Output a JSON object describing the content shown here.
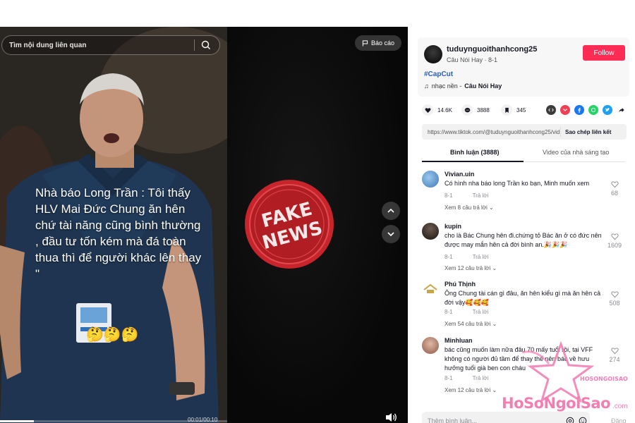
{
  "video": {
    "search_placeholder": "Tìm nội dung liên quan",
    "report_label": "Báo cáo",
    "caption": "Nhà báo Long Trần : Tôi thấy HLV Mai Đức Chung ăn hên chứ tài năng cũng bình thường , đầu tư tốn kém mà đá toàn thua thì để người khác lên thay \"",
    "caption_emojis": "🤔🤔🤔",
    "stamp_top": "FAKE",
    "stamp_bottom": "NEWS",
    "time": "00:01/00:10",
    "progress": 0.15
  },
  "author": {
    "username": "tuduynguoithanhcong25",
    "subtitle": "Câu Nói Hay · 8-1",
    "follow_label": "Follow",
    "hashtag": "#CapCut",
    "music_prefix": "nhạc nền - ",
    "music_name": "Câu Nói Hay"
  },
  "stats": {
    "likes": "14.6K",
    "comments": "3888",
    "saves": "345"
  },
  "share_icons": [
    "embed-icon",
    "pocket-icon",
    "facebook-icon",
    "whatsapp-icon",
    "twitter-icon",
    "share-arrow-icon"
  ],
  "link": {
    "url": "https://www.tiktok.com/@tuduynguoithanhcong25/vid",
    "copy_label": "Sao chép liên kết"
  },
  "tabs": {
    "comments": "Bình luận (3888)",
    "creator_videos": "Video của nhà sáng tạo"
  },
  "comments": [
    {
      "user": "Vivian.uin",
      "text": "Có hình nha báo long Trần ko bạn, Minh muốn xem",
      "date": "8-1",
      "reply_label": "Trả lời",
      "likes": "68",
      "view_replies": "Xem 8 câu trả lời",
      "avatar_color": "#4f8fc9"
    },
    {
      "user": "kupin",
      "text": "cho là Bác Chung hên đi.chứng tỏ Bác ăn ở có đức nên được may mắn hên cả đời bình an.🎉🎉🎉",
      "date": "8-1",
      "reply_label": "Trả lời",
      "likes": "1609",
      "view_replies": "Xem 12 câu trả lời",
      "avatar_color": "#2a2220"
    },
    {
      "user": "Phú Thịnh",
      "text": "Ông Chung tài cán gì đâu, ăn hên kiểu gì mà ăn hên cả đời vậy🥰🥰🥰",
      "date": "8-1",
      "reply_label": "Trả lời",
      "likes": "508",
      "view_replies": "Xem 54 câu trả lời",
      "avatar_color": "#c9a54a"
    },
    {
      "user": "Minhluan",
      "text": "bác cũng muốn làm nữa đâu 70 mấy tuổi rồi, tại VFF không có người đủ tầm để thay thế nên bác về hưu hưởng tuổi già ben con cháu",
      "date": "8-1",
      "reply_label": "Trả lời",
      "likes": "274",
      "view_replies": "Xem 12 câu trả lời",
      "avatar_color": "#b67c66"
    }
  ],
  "comment_box": {
    "placeholder": "Thêm bình luận...",
    "post_label": "Đăng"
  },
  "watermark": {
    "text": "HoSoNgoiSao",
    "suffix": ".com",
    "logo_text": "HOSONGOISAO"
  }
}
